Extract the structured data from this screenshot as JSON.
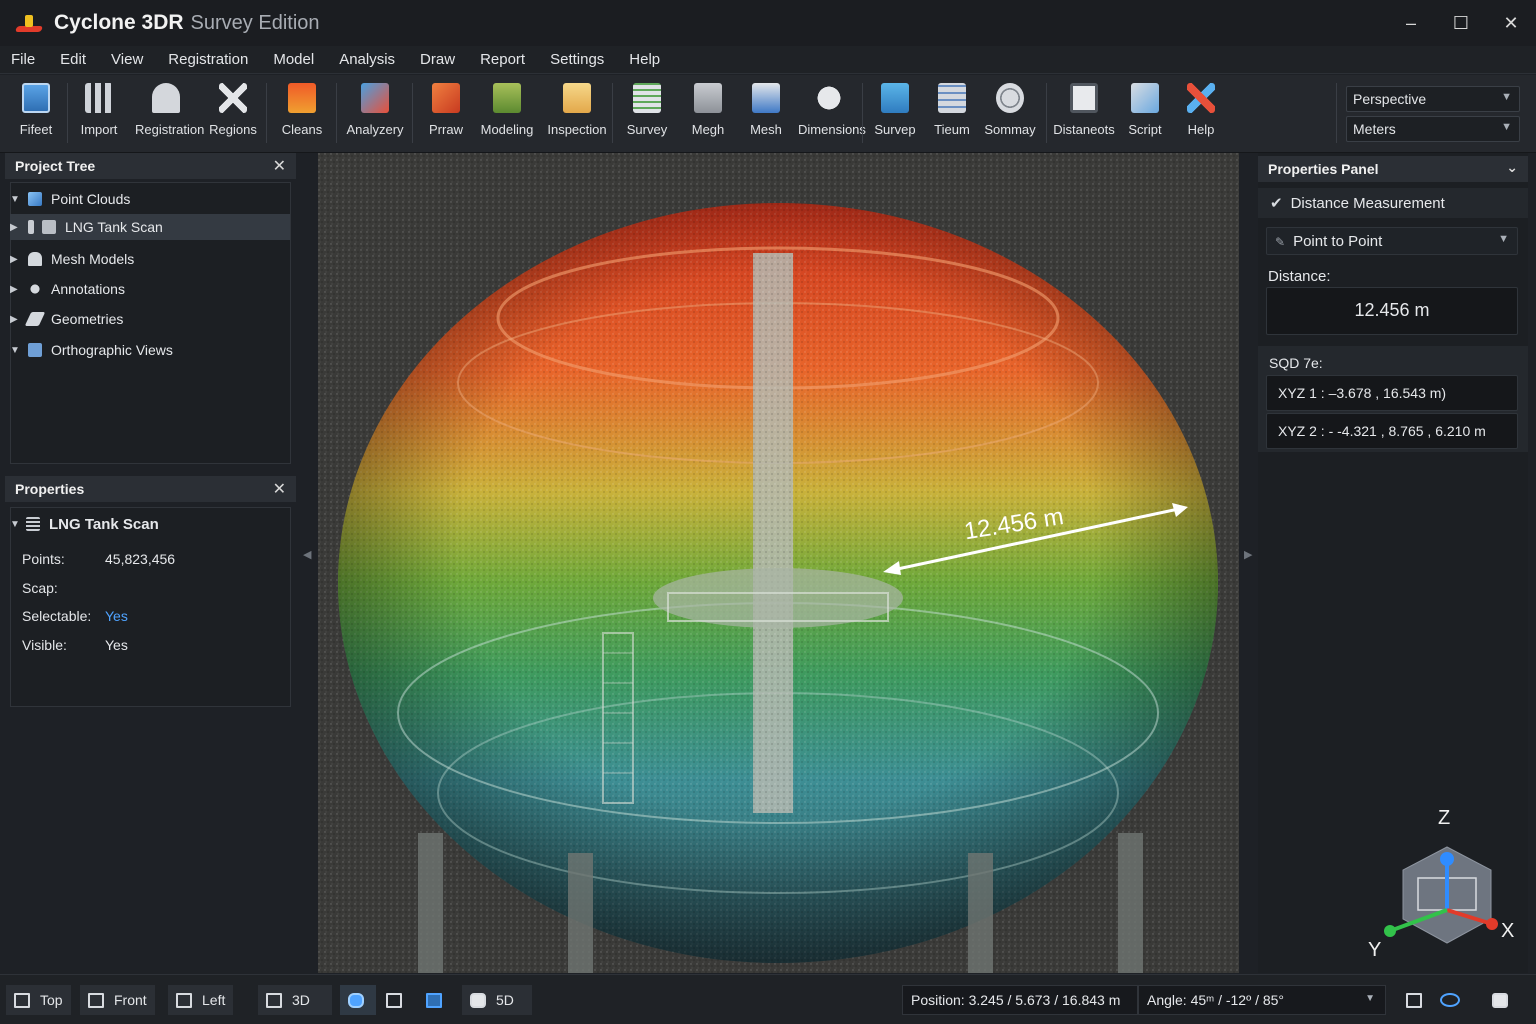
{
  "window": {
    "title": "Cyclone 3DR",
    "edition": "Survey Edition",
    "controls": [
      "–",
      "☐",
      "✕"
    ]
  },
  "menu": [
    "File",
    "Edit",
    "View",
    "Registration",
    "Model",
    "Analysis",
    "Draw",
    "Report",
    "Settings",
    "Help"
  ],
  "toolbar": {
    "tools": [
      {
        "label": "Fifeet",
        "icon": "file-icon"
      },
      {
        "label": "Import",
        "icon": "grid-icon"
      },
      {
        "label": "Registration",
        "icon": "registration-icon"
      },
      {
        "label": "Regions",
        "icon": "regions-icon"
      },
      {
        "label": "Cleans",
        "icon": "clean-icon"
      },
      {
        "label": "Analyzery",
        "icon": "analysis-icon"
      },
      {
        "label": "Prraw",
        "icon": "draw-icon"
      },
      {
        "label": "Modeling",
        "icon": "modeling-icon"
      },
      {
        "label": "Inspection",
        "icon": "inspection-icon"
      },
      {
        "label": "Survey",
        "icon": "survey-icon"
      },
      {
        "label": "Megh",
        "icon": "mesh-stack-icon"
      },
      {
        "label": "Mesh",
        "icon": "mesh-icon"
      },
      {
        "label": "Dimensions",
        "icon": "dimensions-icon"
      },
      {
        "label": "Survep",
        "icon": "survey-post-icon"
      },
      {
        "label": "Tieum",
        "icon": "tieum-icon"
      },
      {
        "label": "Sommay",
        "icon": "globe-icon"
      },
      {
        "label": "Distaneots",
        "icon": "distance-icon"
      },
      {
        "label": "Script",
        "icon": "script-icon"
      },
      {
        "label": "Help",
        "icon": "help-icon"
      }
    ],
    "view_mode": "Perspective",
    "units": "Meters"
  },
  "project_tree": {
    "title": "Project Tree",
    "items": [
      {
        "label": "Point Clouds",
        "expanded": true,
        "level": 0
      },
      {
        "label": "LNG Tank Scan",
        "expanded": false,
        "level": 1,
        "selected": true
      },
      {
        "label": "Mesh Models",
        "expanded": false,
        "level": 0
      },
      {
        "label": "Annotations",
        "expanded": false,
        "level": 0
      },
      {
        "label": "Geometries",
        "expanded": false,
        "level": 0
      },
      {
        "label": "Orthographic Views",
        "expanded": true,
        "level": 0
      }
    ]
  },
  "properties": {
    "title": "Properties",
    "object": "LNG Tank Scan",
    "rows": [
      {
        "key": "Points:",
        "value": "45,823,456",
        "accent": false
      },
      {
        "key": "Scap:",
        "value": "",
        "accent": false
      },
      {
        "key": "Selectable:",
        "value": "Yes",
        "accent": true
      },
      {
        "key": "Visible:",
        "value": "Yes",
        "accent": false
      }
    ]
  },
  "viewport": {
    "measure_label": "12.456 m",
    "axes": {
      "z": "Z",
      "x": "X",
      "y": "Y"
    }
  },
  "properties_panel": {
    "title": "Properties Panel",
    "section": "Distance Measurement",
    "mode": "Point to Point",
    "distance_label": "Distance:",
    "distance_value": "12.456 m",
    "coords_label": "SQD 7e:",
    "xyz1": "XYZ 1 :   –3.678 ,  16.543  m)",
    "xyz2": "XYZ 2 :  - -4.321 ,  8.765 ,  6.210 m"
  },
  "statusbar": {
    "views": [
      "Top",
      "Front",
      "Left",
      "3D",
      "5D"
    ],
    "position": "Position:  3.245 / 5.673 / 16.843 m",
    "angle": "Angle:  45ᵐ / -12º / 85°"
  },
  "colors": {
    "accent": "#4fa3ff",
    "background": "#1e2126",
    "panel": "#1c1f23",
    "header": "#2b2f35"
  }
}
